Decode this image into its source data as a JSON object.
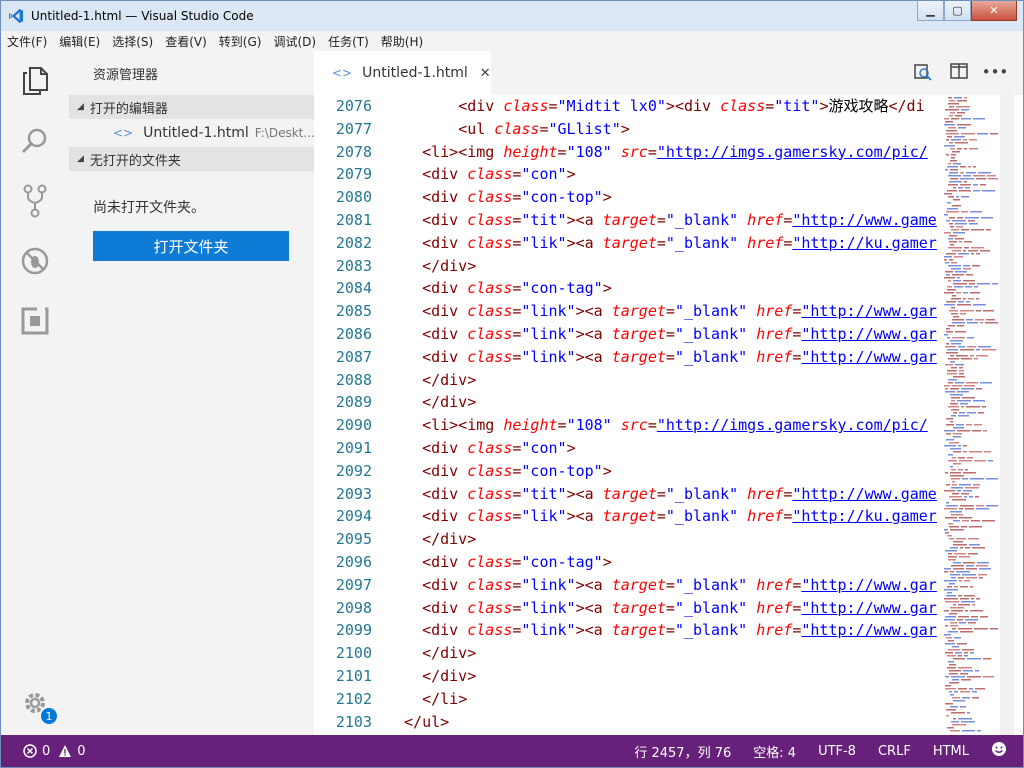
{
  "window": {
    "title": "Untitled-1.html — Visual Studio Code"
  },
  "menu": [
    "文件(F)",
    "编辑(E)",
    "选择(S)",
    "查看(V)",
    "转到(G)",
    "调试(D)",
    "任务(T)",
    "帮助(H)"
  ],
  "sidebar": {
    "title": "资源管理器",
    "open_editors": "打开的编辑器",
    "file_name": "Untitled-1.html",
    "file_path": "F:\\Deskt...",
    "no_folder": "无打开的文件夹",
    "message": "尚未打开文件夹。",
    "open_button": "打开文件夹"
  },
  "tab": {
    "label": "Untitled-1.html",
    "close": "✕"
  },
  "settings_badge": "1",
  "status": {
    "errors": "0",
    "warnings": "0",
    "position": "行 2457，列 76",
    "spaces": "空格: 4",
    "encoding": "UTF-8",
    "eol": "CRLF",
    "language": "HTML"
  },
  "colors": {
    "statusbar": "#68217a",
    "accent": "#0e7bd6"
  },
  "code_lines": [
    {
      "n": "2076",
      "i": 6,
      "t": [
        [
          "pun",
          "<"
        ],
        [
          "tag",
          "div"
        ],
        [
          "at",
          " class"
        ],
        [
          "pun",
          "="
        ],
        [
          "val",
          "\"Midtit lx0\""
        ],
        [
          "pun",
          ">"
        ],
        [
          "pun",
          "<"
        ],
        [
          "tag",
          "div"
        ],
        [
          "at",
          " class"
        ],
        [
          "pun",
          "="
        ],
        [
          "val",
          "\"tit\""
        ],
        [
          "pun",
          ">"
        ],
        [
          "txt",
          "游戏攻略"
        ],
        [
          "pun",
          "</"
        ],
        [
          "tag",
          "di"
        ]
      ]
    },
    {
      "n": "2077",
      "i": 6,
      "t": [
        [
          "pun",
          "<"
        ],
        [
          "tag",
          "ul"
        ],
        [
          "at",
          " class"
        ],
        [
          "pun",
          "="
        ],
        [
          "val",
          "\"GLlist\""
        ],
        [
          "pun",
          ">"
        ]
      ]
    },
    {
      "n": "2078",
      "i": 2,
      "t": [
        [
          "pun",
          "<"
        ],
        [
          "tag",
          "li"
        ],
        [
          "pun",
          "><"
        ],
        [
          "tag",
          "img"
        ],
        [
          "at",
          " height"
        ],
        [
          "pun",
          "="
        ],
        [
          "val",
          "\"108\""
        ],
        [
          "at",
          " src"
        ],
        [
          "pun",
          "="
        ],
        [
          "lnk",
          "\"http://imgs.gamersky.com/pic/"
        ]
      ]
    },
    {
      "n": "2079",
      "i": 2,
      "t": [
        [
          "pun",
          "<"
        ],
        [
          "tag",
          "div"
        ],
        [
          "at",
          " class"
        ],
        [
          "pun",
          "="
        ],
        [
          "val",
          "\"con\""
        ],
        [
          "pun",
          ">"
        ]
      ]
    },
    {
      "n": "2080",
      "i": 2,
      "t": [
        [
          "pun",
          "<"
        ],
        [
          "tag",
          "div"
        ],
        [
          "at",
          " class"
        ],
        [
          "pun",
          "="
        ],
        [
          "val",
          "\"con-top\""
        ],
        [
          "pun",
          ">"
        ]
      ]
    },
    {
      "n": "2081",
      "i": 2,
      "t": [
        [
          "pun",
          "<"
        ],
        [
          "tag",
          "div"
        ],
        [
          "at",
          " class"
        ],
        [
          "pun",
          "="
        ],
        [
          "val",
          "\"tit\""
        ],
        [
          "pun",
          "><"
        ],
        [
          "tag",
          "a"
        ],
        [
          "at",
          " target"
        ],
        [
          "pun",
          "="
        ],
        [
          "val",
          "\"_blank\""
        ],
        [
          "at",
          " href"
        ],
        [
          "pun",
          "="
        ],
        [
          "lnk",
          "\"http://www.game"
        ]
      ]
    },
    {
      "n": "2082",
      "i": 2,
      "t": [
        [
          "pun",
          "<"
        ],
        [
          "tag",
          "div"
        ],
        [
          "at",
          " class"
        ],
        [
          "pun",
          "="
        ],
        [
          "val",
          "\"lik\""
        ],
        [
          "pun",
          "><"
        ],
        [
          "tag",
          "a"
        ],
        [
          "at",
          " target"
        ],
        [
          "pun",
          "="
        ],
        [
          "val",
          "\"_blank\""
        ],
        [
          "at",
          " href"
        ],
        [
          "pun",
          "="
        ],
        [
          "lnk",
          "\"http://ku.gamer"
        ]
      ]
    },
    {
      "n": "2083",
      "i": 2,
      "t": [
        [
          "pun",
          "</"
        ],
        [
          "tag",
          "div"
        ],
        [
          "pun",
          ">"
        ]
      ]
    },
    {
      "n": "2084",
      "i": 2,
      "t": [
        [
          "pun",
          "<"
        ],
        [
          "tag",
          "div"
        ],
        [
          "at",
          " class"
        ],
        [
          "pun",
          "="
        ],
        [
          "val",
          "\"con-tag\""
        ],
        [
          "pun",
          ">"
        ]
      ]
    },
    {
      "n": "2085",
      "i": 2,
      "t": [
        [
          "pun",
          "<"
        ],
        [
          "tag",
          "div"
        ],
        [
          "at",
          " class"
        ],
        [
          "pun",
          "="
        ],
        [
          "val",
          "\"link\""
        ],
        [
          "pun",
          "><"
        ],
        [
          "tag",
          "a"
        ],
        [
          "at",
          " target"
        ],
        [
          "pun",
          "="
        ],
        [
          "val",
          "\"_blank\""
        ],
        [
          "at",
          " href"
        ],
        [
          "pun",
          "="
        ],
        [
          "lnk",
          "\"http://www.gar"
        ]
      ]
    },
    {
      "n": "2086",
      "i": 2,
      "t": [
        [
          "pun",
          "<"
        ],
        [
          "tag",
          "div"
        ],
        [
          "at",
          " class"
        ],
        [
          "pun",
          "="
        ],
        [
          "val",
          "\"link\""
        ],
        [
          "pun",
          "><"
        ],
        [
          "tag",
          "a"
        ],
        [
          "at",
          " target"
        ],
        [
          "pun",
          "="
        ],
        [
          "val",
          "\"_blank\""
        ],
        [
          "at",
          " href"
        ],
        [
          "pun",
          "="
        ],
        [
          "lnk",
          "\"http://www.gar"
        ]
      ]
    },
    {
      "n": "2087",
      "i": 2,
      "t": [
        [
          "pun",
          "<"
        ],
        [
          "tag",
          "div"
        ],
        [
          "at",
          " class"
        ],
        [
          "pun",
          "="
        ],
        [
          "val",
          "\"link\""
        ],
        [
          "pun",
          "><"
        ],
        [
          "tag",
          "a"
        ],
        [
          "at",
          " target"
        ],
        [
          "pun",
          "="
        ],
        [
          "val",
          "\"_blank\""
        ],
        [
          "at",
          " href"
        ],
        [
          "pun",
          "="
        ],
        [
          "lnk",
          "\"http://www.gar"
        ]
      ]
    },
    {
      "n": "2088",
      "i": 2,
      "t": [
        [
          "pun",
          "</"
        ],
        [
          "tag",
          "div"
        ],
        [
          "pun",
          ">"
        ]
      ]
    },
    {
      "n": "2089",
      "i": 2,
      "t": [
        [
          "pun",
          "</"
        ],
        [
          "tag",
          "div"
        ],
        [
          "pun",
          ">"
        ]
      ]
    },
    {
      "n": "2090",
      "i": 2,
      "t": [
        [
          "pun",
          "<"
        ],
        [
          "tag",
          "li"
        ],
        [
          "pun",
          "><"
        ],
        [
          "tag",
          "img"
        ],
        [
          "at",
          " height"
        ],
        [
          "pun",
          "="
        ],
        [
          "val",
          "\"108\""
        ],
        [
          "at",
          " src"
        ],
        [
          "pun",
          "="
        ],
        [
          "lnk",
          "\"http://imgs.gamersky.com/pic/"
        ]
      ]
    },
    {
      "n": "2091",
      "i": 2,
      "t": [
        [
          "pun",
          "<"
        ],
        [
          "tag",
          "div"
        ],
        [
          "at",
          " class"
        ],
        [
          "pun",
          "="
        ],
        [
          "val",
          "\"con\""
        ],
        [
          "pun",
          ">"
        ]
      ]
    },
    {
      "n": "2092",
      "i": 2,
      "t": [
        [
          "pun",
          "<"
        ],
        [
          "tag",
          "div"
        ],
        [
          "at",
          " class"
        ],
        [
          "pun",
          "="
        ],
        [
          "val",
          "\"con-top\""
        ],
        [
          "pun",
          ">"
        ]
      ]
    },
    {
      "n": "2093",
      "i": 2,
      "t": [
        [
          "pun",
          "<"
        ],
        [
          "tag",
          "div"
        ],
        [
          "at",
          " class"
        ],
        [
          "pun",
          "="
        ],
        [
          "val",
          "\"tit\""
        ],
        [
          "pun",
          "><"
        ],
        [
          "tag",
          "a"
        ],
        [
          "at",
          " target"
        ],
        [
          "pun",
          "="
        ],
        [
          "val",
          "\"_blank\""
        ],
        [
          "at",
          " href"
        ],
        [
          "pun",
          "="
        ],
        [
          "lnk",
          "\"http://www.game"
        ]
      ]
    },
    {
      "n": "2094",
      "i": 2,
      "t": [
        [
          "pun",
          "<"
        ],
        [
          "tag",
          "div"
        ],
        [
          "at",
          " class"
        ],
        [
          "pun",
          "="
        ],
        [
          "val",
          "\"lik\""
        ],
        [
          "pun",
          "><"
        ],
        [
          "tag",
          "a"
        ],
        [
          "at",
          " target"
        ],
        [
          "pun",
          "="
        ],
        [
          "val",
          "\"_blank\""
        ],
        [
          "at",
          " href"
        ],
        [
          "pun",
          "="
        ],
        [
          "lnk",
          "\"http://ku.gamer"
        ]
      ]
    },
    {
      "n": "2095",
      "i": 2,
      "t": [
        [
          "pun",
          "</"
        ],
        [
          "tag",
          "div"
        ],
        [
          "pun",
          ">"
        ]
      ]
    },
    {
      "n": "2096",
      "i": 2,
      "t": [
        [
          "pun",
          "<"
        ],
        [
          "tag",
          "div"
        ],
        [
          "at",
          " class"
        ],
        [
          "pun",
          "="
        ],
        [
          "val",
          "\"con-tag\""
        ],
        [
          "pun",
          ">"
        ]
      ]
    },
    {
      "n": "2097",
      "i": 2,
      "t": [
        [
          "pun",
          "<"
        ],
        [
          "tag",
          "div"
        ],
        [
          "at",
          " class"
        ],
        [
          "pun",
          "="
        ],
        [
          "val",
          "\"link\""
        ],
        [
          "pun",
          "><"
        ],
        [
          "tag",
          "a"
        ],
        [
          "at",
          " target"
        ],
        [
          "pun",
          "="
        ],
        [
          "val",
          "\"_blank\""
        ],
        [
          "at",
          " href"
        ],
        [
          "pun",
          "="
        ],
        [
          "lnk",
          "\"http://www.gar"
        ]
      ]
    },
    {
      "n": "2098",
      "i": 2,
      "t": [
        [
          "pun",
          "<"
        ],
        [
          "tag",
          "div"
        ],
        [
          "at",
          " class"
        ],
        [
          "pun",
          "="
        ],
        [
          "val",
          "\"link\""
        ],
        [
          "pun",
          "><"
        ],
        [
          "tag",
          "a"
        ],
        [
          "at",
          " target"
        ],
        [
          "pun",
          "="
        ],
        [
          "val",
          "\"_blank\""
        ],
        [
          "at",
          " href"
        ],
        [
          "pun",
          "="
        ],
        [
          "lnk",
          "\"http://www.gar"
        ]
      ]
    },
    {
      "n": "2099",
      "i": 2,
      "t": [
        [
          "pun",
          "<"
        ],
        [
          "tag",
          "div"
        ],
        [
          "at",
          " class"
        ],
        [
          "pun",
          "="
        ],
        [
          "val",
          "\"link\""
        ],
        [
          "pun",
          "><"
        ],
        [
          "tag",
          "a"
        ],
        [
          "at",
          " target"
        ],
        [
          "pun",
          "="
        ],
        [
          "val",
          "\"_blank\""
        ],
        [
          "at",
          " href"
        ],
        [
          "pun",
          "="
        ],
        [
          "lnk",
          "\"http://www.gar"
        ]
      ]
    },
    {
      "n": "2100",
      "i": 2,
      "t": [
        [
          "pun",
          "</"
        ],
        [
          "tag",
          "div"
        ],
        [
          "pun",
          ">"
        ]
      ]
    },
    {
      "n": "2101",
      "i": 2,
      "t": [
        [
          "pun",
          "</"
        ],
        [
          "tag",
          "div"
        ],
        [
          "pun",
          ">"
        ]
      ]
    },
    {
      "n": "2102",
      "i": 2,
      "t": [
        [
          "pun",
          "</"
        ],
        [
          "tag",
          "li"
        ],
        [
          "pun",
          ">"
        ]
      ]
    },
    {
      "n": "2103",
      "i": 0,
      "t": [
        [
          "pun",
          "</"
        ],
        [
          "tag",
          "ul"
        ],
        [
          "pun",
          ">"
        ]
      ]
    }
  ]
}
